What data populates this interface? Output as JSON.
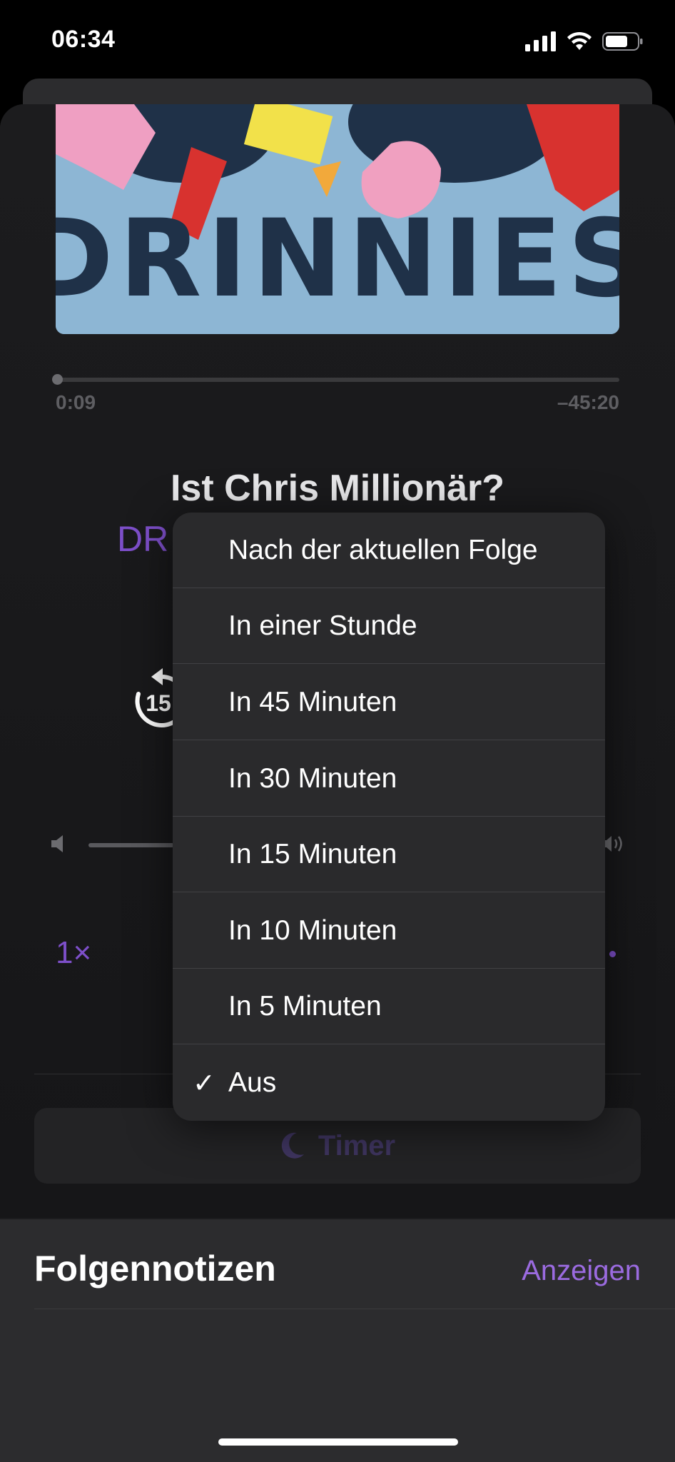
{
  "status_bar": {
    "time": "06:34"
  },
  "player": {
    "artwork_text": "DRINNIES",
    "elapsed": "0:09",
    "remaining": "–45:20",
    "progress_fraction": 0.004,
    "episode_title": "Ist Chris Millionär?",
    "podcast_name_visible": "DR",
    "skip_back_seconds": "15",
    "speed": "1×",
    "timer_label": "Timer"
  },
  "notes": {
    "title": "Folgennotizen",
    "link": "Anzeigen"
  },
  "timer_menu": {
    "items": [
      {
        "label": "Nach der aktuellen Folge",
        "checked": false
      },
      {
        "label": "In einer Stunde",
        "checked": false
      },
      {
        "label": "In 45 Minuten",
        "checked": false
      },
      {
        "label": "In 30 Minuten",
        "checked": false
      },
      {
        "label": "In 15 Minuten",
        "checked": false
      },
      {
        "label": "In 10 Minuten",
        "checked": false
      },
      {
        "label": "In 5 Minuten",
        "checked": false
      },
      {
        "label": "Aus",
        "checked": true
      }
    ],
    "check_glyph": "✓"
  },
  "colors": {
    "accent": "#7d4fc9",
    "sheet": "#1c1c1e",
    "menu": "#2a2a2c"
  }
}
